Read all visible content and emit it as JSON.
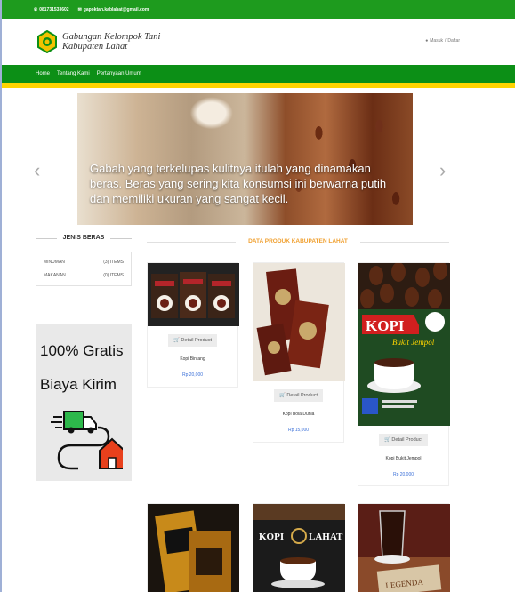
{
  "topbar": {
    "phone": "081731533602",
    "email": "gapoktan.kablahat@gmail.com"
  },
  "header": {
    "logo_line1": "Gabungan Kelompok Tani",
    "logo_line2": "Kabupaten Lahat",
    "login": "Masuk",
    "separator": "/",
    "register": "Daftar"
  },
  "nav": {
    "items": [
      "Home",
      "Tentang Kami",
      "Pertanyaan Umum"
    ]
  },
  "slider": {
    "caption": "Gabah yang terkelupas kulitnya itulah yang dinamakan beras. Beras yang sering kita konsumsi ini berwarna putih dan memiliki ukuran yang sangat kecil.",
    "prev": "‹",
    "next": "›"
  },
  "sidebar": {
    "title": "JENIS BERAS",
    "categories": [
      {
        "name": "MINUMAN",
        "count": "(3) ITEMS"
      },
      {
        "name": "MAKANAN",
        "count": "(0) ITEMS"
      }
    ],
    "promo_line1": "100% Gratis",
    "promo_line2": "Biaya Kirim"
  },
  "products": {
    "title": "DATA PRODUK KABUPATEN LAHAT",
    "detail_label": "Detail Product",
    "items": [
      {
        "name": "Kopi Bintang",
        "price": "Rp 20,000"
      },
      {
        "name": "Kopi Bola Dunia",
        "price": "Rp 15,000"
      },
      {
        "name": "Kopi Bukit Jempol",
        "price": "Rp 20,000"
      }
    ]
  },
  "product_images": {
    "kopi_brand": "KOPI",
    "kopi_sub": "Bukit Jempol",
    "lahat_left": "KOPI",
    "lahat_right": "LAHAT",
    "legenda": "LEGENDA"
  },
  "colors": {
    "topbar": "#1e9b1e",
    "nav": "#0c8f16",
    "nav_border": "#ffd400",
    "title_accent": "#f0a030",
    "price": "#3a6fd8"
  }
}
